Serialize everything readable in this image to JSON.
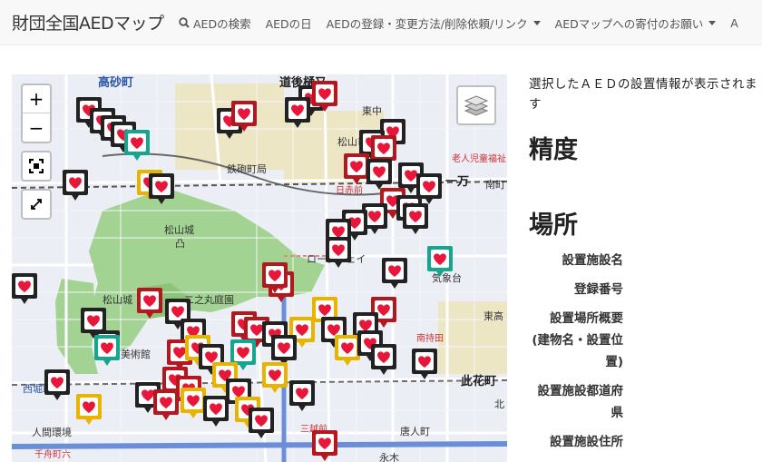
{
  "nav": {
    "brand": "財団全国AEDマップ",
    "links": [
      {
        "label": "AEDの検索",
        "icon": "search-icon",
        "dropdown": false
      },
      {
        "label": "AEDの日",
        "dropdown": false
      },
      {
        "label": "AEDの登録・変更方法/削除依頼/リンク",
        "dropdown": true
      },
      {
        "label": "AEDマップへの寄付のお願い",
        "dropdown": true
      },
      {
        "label": "A",
        "dropdown": false
      }
    ]
  },
  "map": {
    "zoom_in": "+",
    "zoom_out": "−",
    "labels": {
      "takasago": "高砂町",
      "dogo": "道後樋又",
      "tochu": "東中",
      "matsuyama_shi": "松山市",
      "tetsudo": "鉄砲町局",
      "hitoman": "一万",
      "minamimachi": "南町",
      "nisseki": "日赤前",
      "rojin": "老人児童福祉",
      "shiyakusho": "松山城",
      "castle_mark": "凸",
      "ropeway": "ロープウェイ",
      "kiyoshidai": "気象台",
      "higashi": "東高",
      "matsuyama_castle": "松山城",
      "ninomaru": "二之丸庭園",
      "museum": "美術館",
      "nishi": "西堀端",
      "jinkan": "人間環境",
      "minamimoto": "南持田",
      "hanazono": "此花町",
      "chiba": "千舟町六",
      "mitsukoshi": "三越前",
      "karamachi": "唐人町",
      "yokomachi": "永木",
      "kita": "北"
    }
  },
  "info": {
    "intro": "選択したＡＥＤの設置情報が表示されます",
    "precision_heading": "精度",
    "place_heading": "場所",
    "fields": [
      "設置施設名",
      "登録番号",
      "設置場所概要 (建物名・設置位置)",
      "設置施設都道府県",
      "設置施設住所"
    ]
  },
  "colors": {
    "marker_black": "#222222",
    "marker_red": "#b5171e",
    "marker_yellow": "#e8b400",
    "marker_teal": "#16a58f",
    "heart": "#e8173a",
    "park": "#9fcf8f"
  },
  "markers": [
    {
      "c": "black"
    },
    {
      "c": "black"
    },
    {
      "c": "black"
    },
    {
      "c": "black"
    },
    {
      "c": "teal"
    },
    {
      "c": "black"
    },
    {
      "c": "yellow"
    },
    {
      "c": "black"
    },
    {
      "c": "black"
    },
    {
      "c": "red"
    },
    {
      "c": "black"
    },
    {
      "c": "red"
    },
    {
      "c": "black"
    },
    {
      "c": "black"
    },
    {
      "c": "black"
    },
    {
      "c": "red"
    },
    {
      "c": "red"
    },
    {
      "c": "black"
    },
    {
      "c": "black"
    },
    {
      "c": "black"
    },
    {
      "c": "red"
    },
    {
      "c": "black"
    },
    {
      "c": "black"
    },
    {
      "c": "black"
    },
    {
      "c": "black"
    },
    {
      "c": "black"
    },
    {
      "c": "black"
    },
    {
      "c": "teal"
    },
    {
      "c": "black"
    },
    {
      "c": "red"
    },
    {
      "c": "red"
    },
    {
      "c": "black"
    },
    {
      "c": "red"
    },
    {
      "c": "black"
    },
    {
      "c": "black"
    },
    {
      "c": "black"
    },
    {
      "c": "black"
    },
    {
      "c": "teal"
    },
    {
      "c": "red"
    },
    {
      "c": "red"
    },
    {
      "c": "black"
    },
    {
      "c": "yellow"
    },
    {
      "c": "yellow"
    },
    {
      "c": "black"
    },
    {
      "c": "red"
    },
    {
      "c": "black"
    },
    {
      "c": "yellow"
    },
    {
      "c": "black"
    },
    {
      "c": "black"
    },
    {
      "c": "teal"
    },
    {
      "c": "black"
    },
    {
      "c": "red"
    },
    {
      "c": "yellow"
    },
    {
      "c": "black"
    },
    {
      "c": "red"
    },
    {
      "c": "yellow"
    },
    {
      "c": "yellow"
    },
    {
      "c": "black"
    },
    {
      "c": "red"
    },
    {
      "c": "black"
    },
    {
      "c": "black"
    },
    {
      "c": "yellow"
    },
    {
      "c": "black"
    },
    {
      "c": "red"
    },
    {
      "c": "yellow"
    },
    {
      "c": "black"
    },
    {
      "c": "yellow"
    },
    {
      "c": "black"
    },
    {
      "c": "red"
    },
    {
      "c": "black"
    }
  ]
}
